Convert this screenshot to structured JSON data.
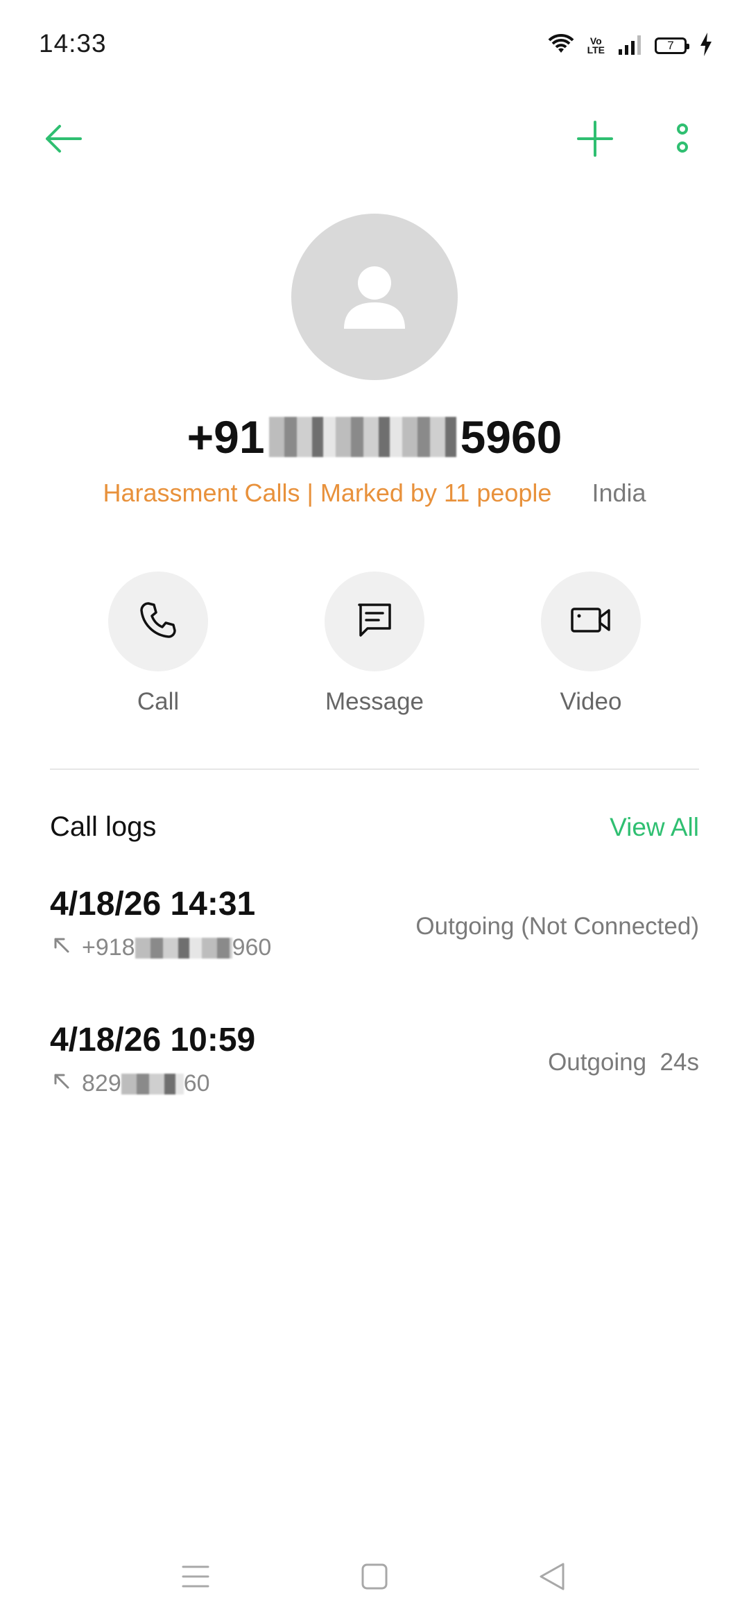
{
  "status_bar": {
    "time": "14:33",
    "volte_top": "Vo",
    "volte_bottom": "LTE",
    "battery": "7",
    "icons": [
      "wifi-icon",
      "volte-icon",
      "signal-icon",
      "battery-icon",
      "charging-icon"
    ]
  },
  "toolbar": {
    "back_icon": "arrow-left-icon",
    "add_icon": "plus-icon",
    "more_icon": "more-vertical-icon",
    "accent_color": "#2fbf71"
  },
  "contact": {
    "avatar_icon": "person-icon",
    "number_prefix": "+91",
    "number_suffix": "5960",
    "spam_label": "Harassment Calls | Marked by 11 people",
    "spam_color": "#e8913b",
    "region": "India"
  },
  "actions": [
    {
      "label": "Call",
      "icon": "phone-icon"
    },
    {
      "label": "Message",
      "icon": "message-icon"
    },
    {
      "label": "Video",
      "icon": "video-icon"
    }
  ],
  "call_logs": {
    "title": "Call logs",
    "view_all": "View All",
    "entries": [
      {
        "datetime": "4/18/26 14:31",
        "number_prefix": "+918",
        "number_suffix": "960",
        "status": "Outgoing (Not Connected)",
        "icon": "outgoing-call-icon"
      },
      {
        "datetime": "4/18/26 10:59",
        "number_prefix": "829",
        "number_suffix": "60",
        "status": "Outgoing  24s",
        "icon": "outgoing-call-icon"
      }
    ]
  },
  "nav_bar": {
    "icons": [
      "menu-icon",
      "home-icon",
      "back-icon"
    ]
  }
}
